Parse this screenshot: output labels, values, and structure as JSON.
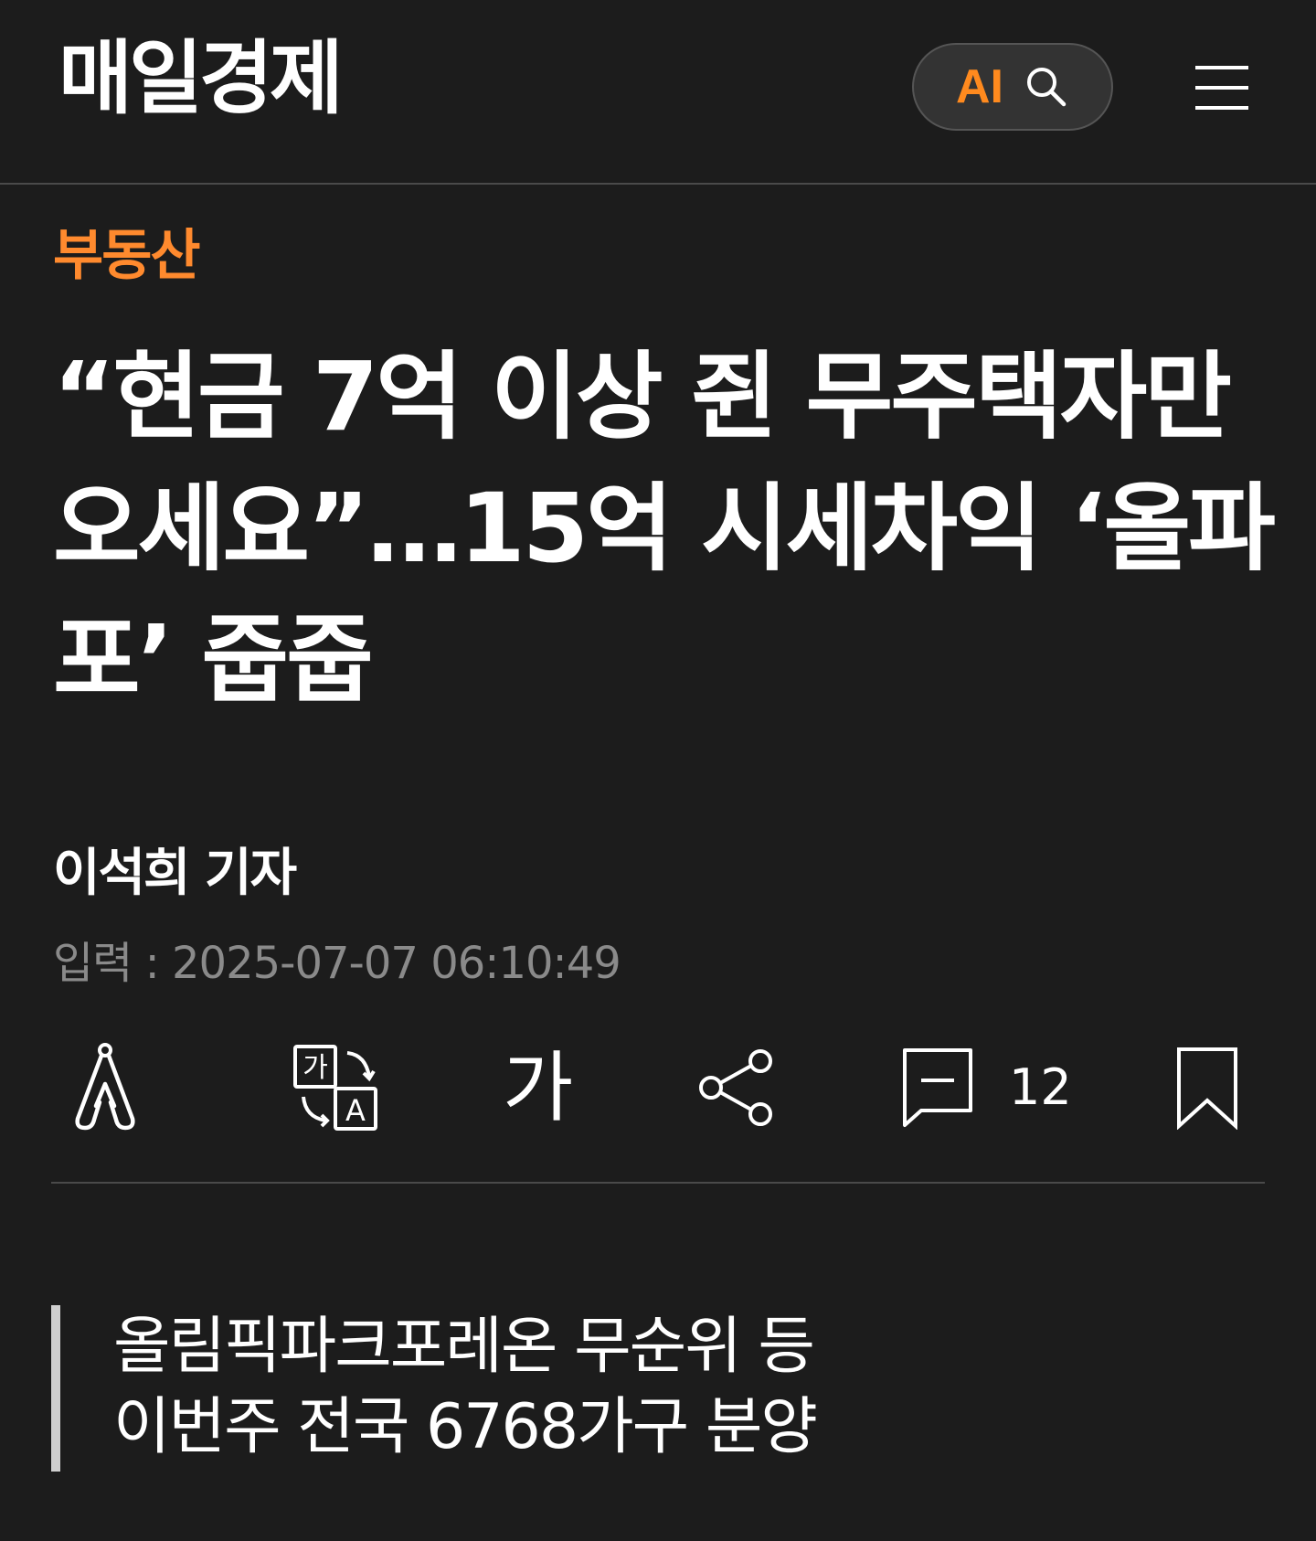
{
  "header": {
    "logo": "매일경제",
    "ai_label": "AI",
    "search_icon": "search-icon",
    "menu_icon": "hamburger-menu-icon"
  },
  "article": {
    "category": "부동산",
    "headline": "“현금 7억 이상 쥔 무주택자만 오세요”…15억 시세차익 ‘올파포’ 줍줍",
    "reporter": "이석희 기자",
    "published": "입력 : 2025-07-07 06:10:49"
  },
  "toolbar": {
    "tts_icon": "audio-read-icon",
    "translate_icon": "translate-icon",
    "font_size_label": "가",
    "share_icon": "share-icon",
    "comment_icon": "comment-icon",
    "comment_count": "12",
    "bookmark_icon": "bookmark-icon"
  },
  "summary": {
    "lines": [
      "올림픽파크포레온 무순위 등",
      "이번주 전국 6768가구 분양"
    ]
  },
  "colors": {
    "background": "#1c1c1c",
    "accent": "#ff8a1e",
    "category": "#ff8a2e",
    "muted_text": "#8a8a8a"
  }
}
